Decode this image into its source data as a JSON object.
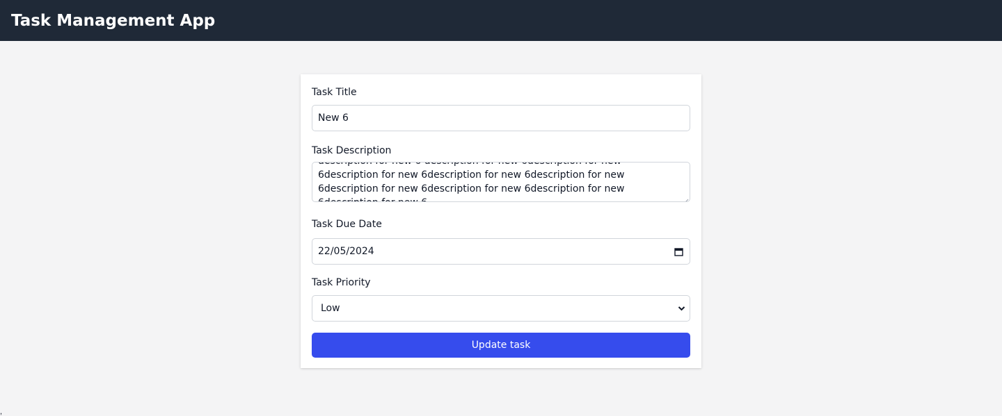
{
  "header": {
    "title": "Task Management App"
  },
  "form": {
    "title_label": "Task Title",
    "title_value": "New 6",
    "description_label": "Task Description",
    "description_value": "description for new 6 description for new 6description for new 6description for new 6description for new 6description for new 6description for new 6description for new 6description for new 6description for new 6",
    "due_date_label": "Task Due Date",
    "due_date_value": "22/05/2024",
    "priority_label": "Task Priority",
    "priority_value": "Low",
    "submit_label": "Update task"
  },
  "icons": {
    "calendar": "calendar-icon",
    "chevron": "chevron-down-icon",
    "resize": "resize-grip-icon"
  },
  "colors": {
    "header_bg": "#1f2937",
    "page_bg": "#f4f4f5",
    "button_bg": "#364ced",
    "border": "#d1d5db"
  },
  "stray_text": ","
}
